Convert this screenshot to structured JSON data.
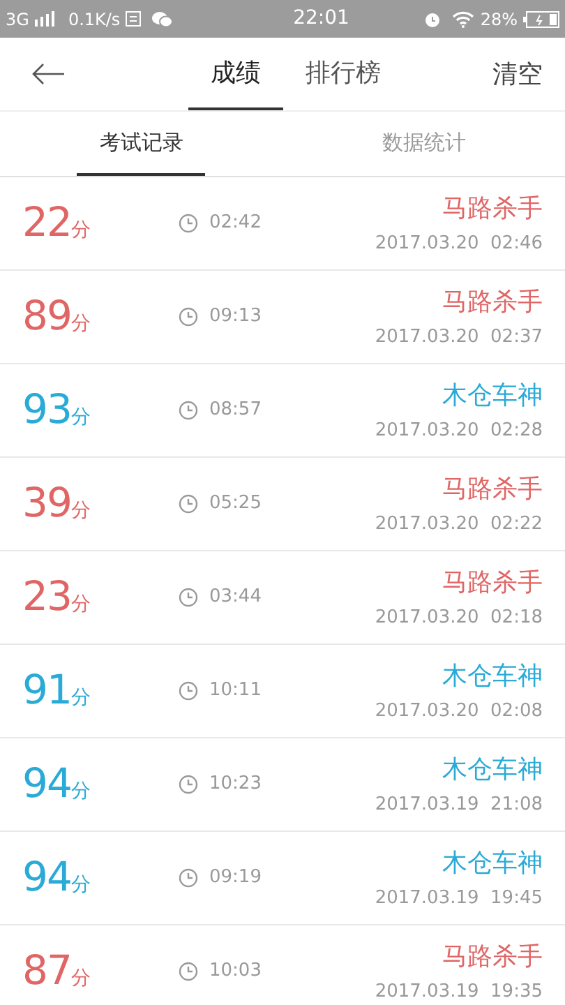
{
  "status_bar": {
    "network": "3G",
    "speed": "0.1K/s",
    "time": "22:01",
    "battery": "28%"
  },
  "nav": {
    "tabs": [
      {
        "label": "成绩",
        "selected": true
      },
      {
        "label": "排行榜",
        "selected": false
      }
    ],
    "action": "清空"
  },
  "sub_tabs": [
    {
      "label": "考试记录",
      "selected": true
    },
    {
      "label": "数据统计",
      "selected": false
    }
  ],
  "records": [
    {
      "score": "22",
      "unit": "分",
      "duration": "02:42",
      "title": "马路杀手",
      "date": "2017.03.20  02:46",
      "color": "#e06666"
    },
    {
      "score": "89",
      "unit": "分",
      "duration": "09:13",
      "title": "马路杀手",
      "date": "2017.03.20  02:37",
      "color": "#e06666"
    },
    {
      "score": "93",
      "unit": "分",
      "duration": "08:57",
      "title": "木仓车神",
      "date": "2017.03.20  02:28",
      "color": "#2aaad6"
    },
    {
      "score": "39",
      "unit": "分",
      "duration": "05:25",
      "title": "马路杀手",
      "date": "2017.03.20  02:22",
      "color": "#e06666"
    },
    {
      "score": "23",
      "unit": "分",
      "duration": "03:44",
      "title": "马路杀手",
      "date": "2017.03.20  02:18",
      "color": "#e06666"
    },
    {
      "score": "91",
      "unit": "分",
      "duration": "10:11",
      "title": "木仓车神",
      "date": "2017.03.20  02:08",
      "color": "#2aaad6"
    },
    {
      "score": "94",
      "unit": "分",
      "duration": "10:23",
      "title": "木仓车神",
      "date": "2017.03.19  21:08",
      "color": "#2aaad6"
    },
    {
      "score": "94",
      "unit": "分",
      "duration": "09:19",
      "title": "木仓车神",
      "date": "2017.03.19  19:45",
      "color": "#2aaad6"
    },
    {
      "score": "87",
      "unit": "分",
      "duration": "10:03",
      "title": "马路杀手",
      "date": "2017.03.19  19:35",
      "color": "#e06666"
    }
  ]
}
